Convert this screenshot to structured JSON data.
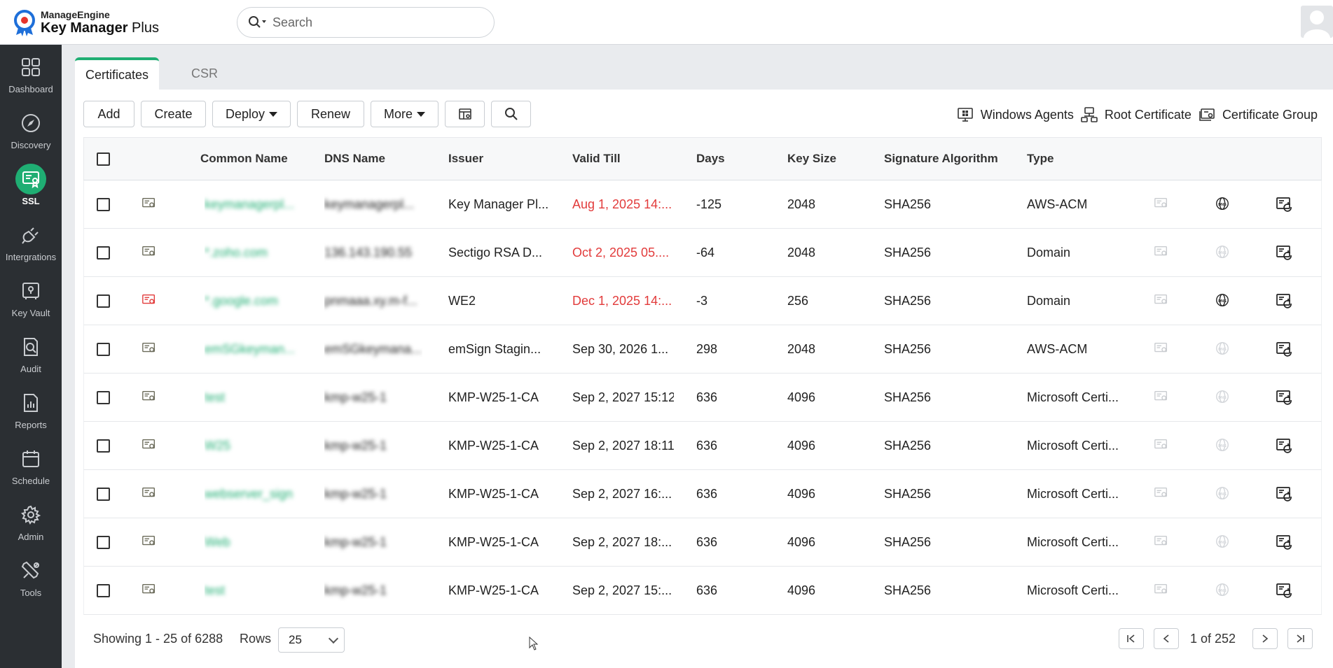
{
  "app": {
    "brand": "ManageEngine",
    "product_main": "Key Manager",
    "product_sub": " Plus"
  },
  "search": {
    "placeholder": "Search"
  },
  "sidebar": {
    "items": [
      {
        "label": "Dashboard",
        "icon": "dashboard-icon"
      },
      {
        "label": "Discovery",
        "icon": "compass-icon"
      },
      {
        "label": "SSL",
        "icon": "certificate-icon",
        "active": true
      },
      {
        "label": "Intergrations",
        "icon": "plug-icon"
      },
      {
        "label": "Key Vault",
        "icon": "vault-icon"
      },
      {
        "label": "Audit",
        "icon": "audit-icon"
      },
      {
        "label": "Reports",
        "icon": "reports-icon"
      },
      {
        "label": "Schedule",
        "icon": "calendar-icon"
      },
      {
        "label": "Admin",
        "icon": "gear-icon"
      },
      {
        "label": "Tools",
        "icon": "tools-icon"
      }
    ]
  },
  "tabs": [
    {
      "label": "Certificates",
      "active": true
    },
    {
      "label": "CSR",
      "active": false
    }
  ],
  "toolbar": {
    "add": "Add",
    "create": "Create",
    "deploy": "Deploy",
    "renew": "Renew",
    "more": "More"
  },
  "links": {
    "windows_agents": "Windows Agents",
    "root_certificate": "Root Certificate",
    "certificate_group": "Certificate Group"
  },
  "table": {
    "headers": {
      "common_name": "Common Name",
      "dns_name": "DNS Name",
      "issuer": "Issuer",
      "valid_till": "Valid Till",
      "days": "Days",
      "key_size": "Key Size",
      "signature_algorithm": "Signature Algorithm",
      "type": "Type"
    },
    "rows": [
      {
        "cn": "keymanagerpl...",
        "dns": "keymanagerpl...",
        "issuer": "Key Manager Pl...",
        "valid": "Aug 1, 2025 14:...",
        "days": "-125",
        "key": "2048",
        "sig": "SHA256",
        "type": "AWS-ACM",
        "expired": true,
        "status": "warn",
        "dns_icon": true
      },
      {
        "cn": "*.zoho.com",
        "dns": "136.143.190.55",
        "issuer": "Sectigo RSA D...",
        "valid": "Oct 2, 2025 05....",
        "days": "-64",
        "key": "2048",
        "sig": "SHA256",
        "type": "Domain",
        "expired": true,
        "status": "warn",
        "dns_icon": false
      },
      {
        "cn": "*.google.com",
        "dns": "pnmaaa.xy.m-f...",
        "issuer": "WE2",
        "valid": "Dec 1, 2025 14:...",
        "days": "-3",
        "key": "256",
        "sig": "SHA256",
        "type": "Domain",
        "expired": true,
        "status": "error",
        "dns_icon": true
      },
      {
        "cn": "emSGkeyman...",
        "dns": "emSGkeymana...",
        "issuer": "emSign Stagin...",
        "valid": "Sep 30, 2026 1...",
        "days": "298",
        "key": "2048",
        "sig": "SHA256",
        "type": "AWS-ACM",
        "expired": false,
        "status": "warn",
        "dns_icon": false
      },
      {
        "cn": "test",
        "dns": "kmp-w25-1",
        "issuer": "KMP-W25-1-CA",
        "valid": "Sep 2, 2027 15:12",
        "days": "636",
        "key": "4096",
        "sig": "SHA256",
        "type": "Microsoft Certi...",
        "expired": false,
        "status": "warn",
        "dns_icon": false
      },
      {
        "cn": "W25",
        "dns": "kmp-w25-1",
        "issuer": "KMP-W25-1-CA",
        "valid": "Sep 2, 2027 18:11",
        "days": "636",
        "key": "4096",
        "sig": "SHA256",
        "type": "Microsoft Certi...",
        "expired": false,
        "status": "warn",
        "dns_icon": false
      },
      {
        "cn": "webserver_sign",
        "dns": "kmp-w25-1",
        "issuer": "KMP-W25-1-CA",
        "valid": "Sep 2, 2027 16:...",
        "days": "636",
        "key": "4096",
        "sig": "SHA256",
        "type": "Microsoft Certi...",
        "expired": false,
        "status": "warn",
        "dns_icon": false
      },
      {
        "cn": "Web",
        "dns": "kmp-w25-1",
        "issuer": "KMP-W25-1-CA",
        "valid": "Sep 2, 2027 18:...",
        "days": "636",
        "key": "4096",
        "sig": "SHA256",
        "type": "Microsoft Certi...",
        "expired": false,
        "status": "warn",
        "dns_icon": false
      },
      {
        "cn": "test",
        "dns": "kmp-w25-1",
        "issuer": "KMP-W25-1-CA",
        "valid": "Sep 2, 2027 15:...",
        "days": "636",
        "key": "4096",
        "sig": "SHA256",
        "type": "Microsoft Certi...",
        "expired": false,
        "status": "warn",
        "dns_icon": false
      }
    ]
  },
  "footer": {
    "showing": "Showing 1 - 25 of 6288",
    "rows_label": "Rows",
    "rows_value": "25",
    "page_text": "1 of 252"
  },
  "colors": {
    "accent": "#1fae73",
    "expired": "#e23b3b",
    "sidebar_bg": "#2b2f33"
  }
}
